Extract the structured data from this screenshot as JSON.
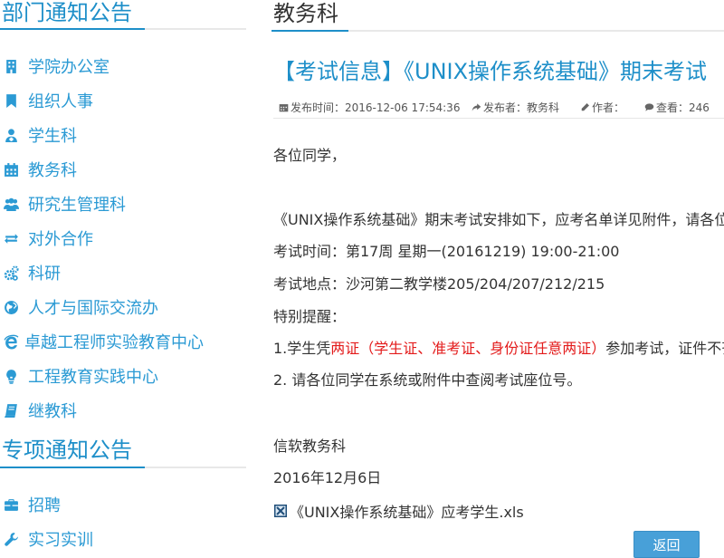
{
  "sidebar": {
    "dept_title": "部门通知公告",
    "dept_items": [
      {
        "label": "学院办公室",
        "icon": "building-icon"
      },
      {
        "label": "组织人事",
        "icon": "bookmark-icon"
      },
      {
        "label": "学生科",
        "icon": "user-md-icon"
      },
      {
        "label": "教务科",
        "icon": "calendar-icon"
      },
      {
        "label": "研究生管理科",
        "icon": "users-icon"
      },
      {
        "label": "对外合作",
        "icon": "exchange-icon"
      },
      {
        "label": "科研",
        "icon": "cogs-icon"
      },
      {
        "label": "人才与国际交流办",
        "icon": "globe-icon"
      },
      {
        "label": "卓越工程师实验教育中心",
        "icon": "ie-icon"
      },
      {
        "label": "工程教育实践中心",
        "icon": "lightbulb-icon"
      },
      {
        "label": "继教科",
        "icon": "book-icon"
      }
    ],
    "special_title": "专项通知公告",
    "special_items": [
      {
        "label": "招聘",
        "icon": "briefcase-icon"
      },
      {
        "label": "实习实训",
        "icon": "wrench-icon"
      }
    ]
  },
  "main": {
    "section_title": "教务科",
    "article_title": "【考试信息】《UNIX操作系统基础》期末考试",
    "meta": {
      "publish_time": "发布时间：2016-12-06 17:54:36",
      "publisher": "发布者：教务科",
      "author": "作者：",
      "views": "查看：246"
    },
    "body": {
      "greeting": "各位同学，",
      "intro": "《UNIX操作系统基础》期末考试安排如下，应考名单详见附件，请各位",
      "time": "考试时间：第17周 星期一(20161219) 19:00-21:00",
      "place": "考试地点：沙河第二教学楼205/204/207/212/215",
      "reminder": "特别提醒：",
      "rule1_prefix": "1.学生凭",
      "rule1_red": "两证（学生证、准考证、身份证任意两证）",
      "rule1_suffix": "参加考试，证件不齐",
      "rule2": "2. 请各位同学在系统或附件中查阅考试座位号。",
      "signature": "信软教务科",
      "date": "2016年12月6日"
    },
    "attachment": "《UNIX操作系统基础》应考学生.xls",
    "back_button": "返回"
  },
  "colors": {
    "accent": "#1e8fc9",
    "link": "#2b9ad4",
    "warning": "#e31b1b",
    "button": "#48a0d8"
  }
}
